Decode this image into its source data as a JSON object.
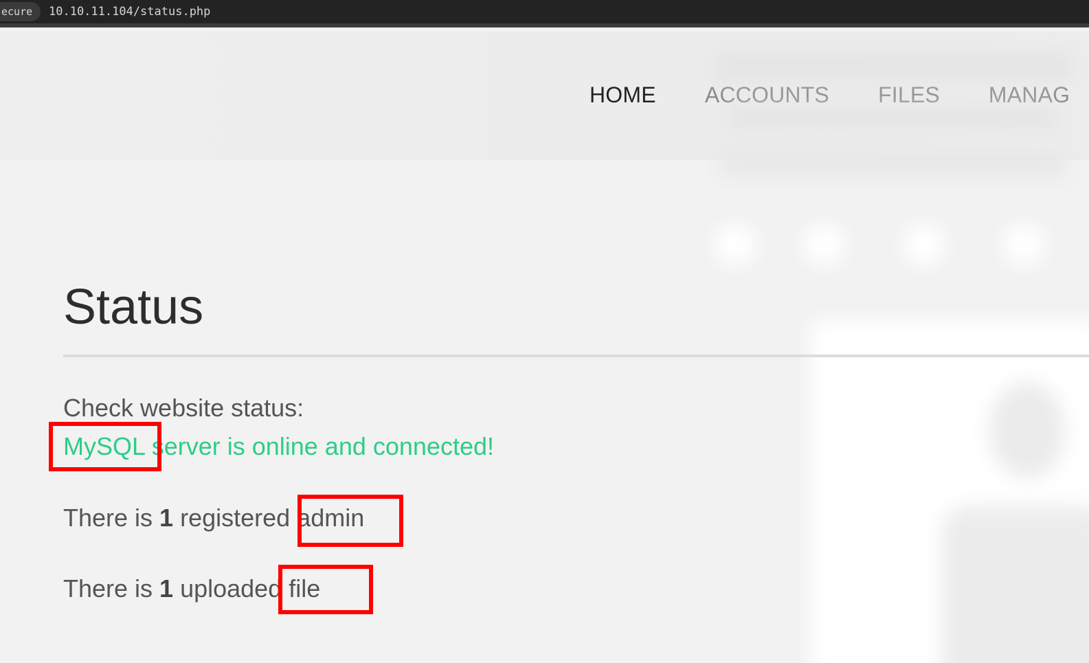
{
  "browser": {
    "security_label": "ecure",
    "url": "10.10.11.104/status.php"
  },
  "nav": {
    "items": [
      {
        "label": "HOME",
        "active": true
      },
      {
        "label": "ACCOUNTS",
        "active": false
      },
      {
        "label": "FILES",
        "active": false
      },
      {
        "label": "MANAG",
        "active": false
      }
    ]
  },
  "main": {
    "title": "Status",
    "check_label": "Check website status:",
    "mysql_status": "MySQL server is online and connected!",
    "admins": {
      "prefix": "There is ",
      "count": "1",
      "suffix": " registered admin"
    },
    "files": {
      "prefix": "There is ",
      "count": "1",
      "suffix": " uploaded file"
    }
  },
  "colors": {
    "online_status": "#2ecc8a",
    "annotation_box": "#ff0000",
    "nav_active": "#222222",
    "nav_inactive": "#8a8a8a"
  }
}
